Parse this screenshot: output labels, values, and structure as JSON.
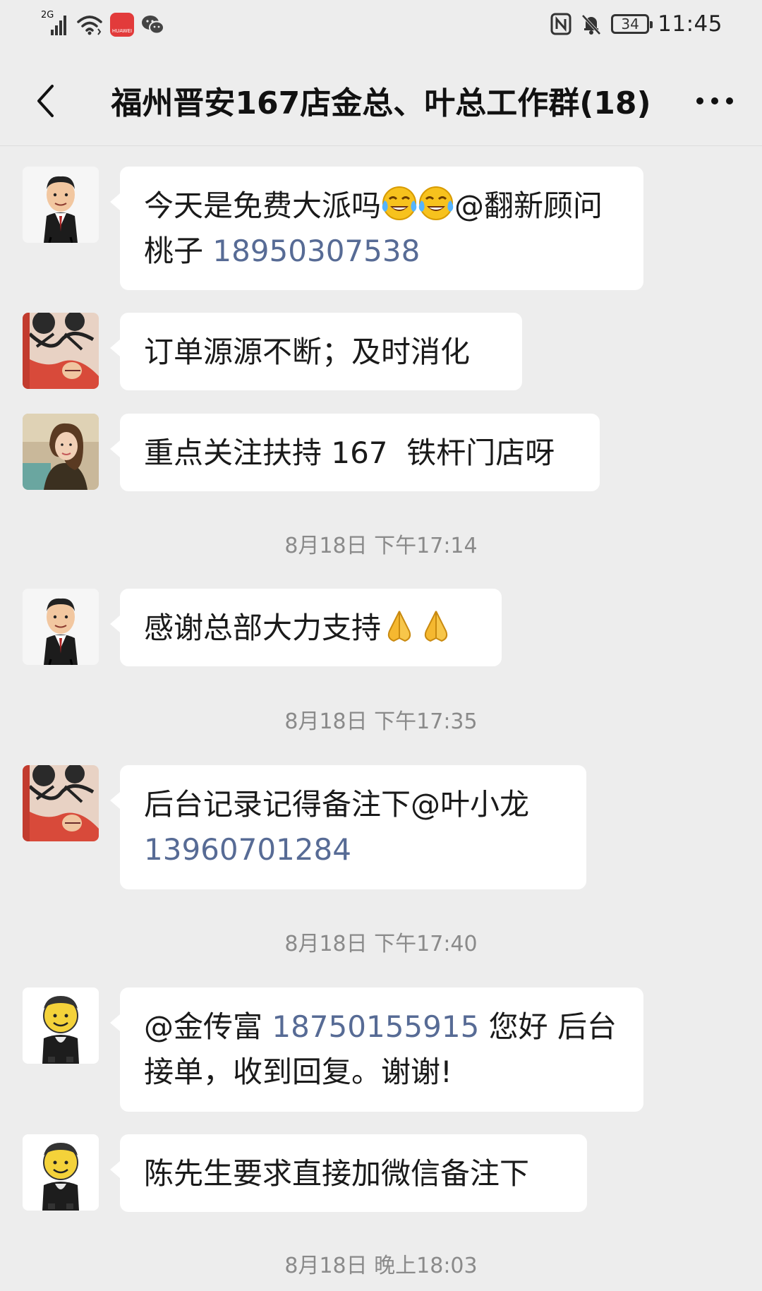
{
  "status_bar": {
    "network": "2G",
    "battery": "34",
    "time": "11:45",
    "huawei_label": "HUAWEI"
  },
  "nav": {
    "title": "福州晋安167店金总、叶总工作群(18)"
  },
  "messages": [
    {
      "segments": {
        "a": "今天是免费大派吗",
        "b": "@翻新顾问桃子 ",
        "phone": "18950307538"
      }
    },
    {
      "text": "订单源源不断；及时消化"
    },
    {
      "text": "重点关注扶持 167  铁杆门店呀"
    },
    {
      "text": "感谢总部大力支持"
    },
    {
      "segments": {
        "a": "后台记录记得备注下@叶小龙 ",
        "phone": "13960701284"
      }
    },
    {
      "segments": {
        "a": "@金传富 ",
        "phone": "18750155915",
        "b": " 您好 后台接单，收到回复。谢谢!"
      }
    },
    {
      "text": "陈先生要求直接加微信备注下"
    }
  ],
  "timestamps": [
    "8月18日 下午17:14",
    "8月18日 下午17:35",
    "8月18日 下午17:40",
    "8月18日 晚上18:03"
  ],
  "icons": {
    "back": "chevron-left-icon",
    "more": "more-dots-icon",
    "emoji_cry": "crying-laughing-emoji",
    "emoji_pray": "praying-hands-emoji"
  }
}
